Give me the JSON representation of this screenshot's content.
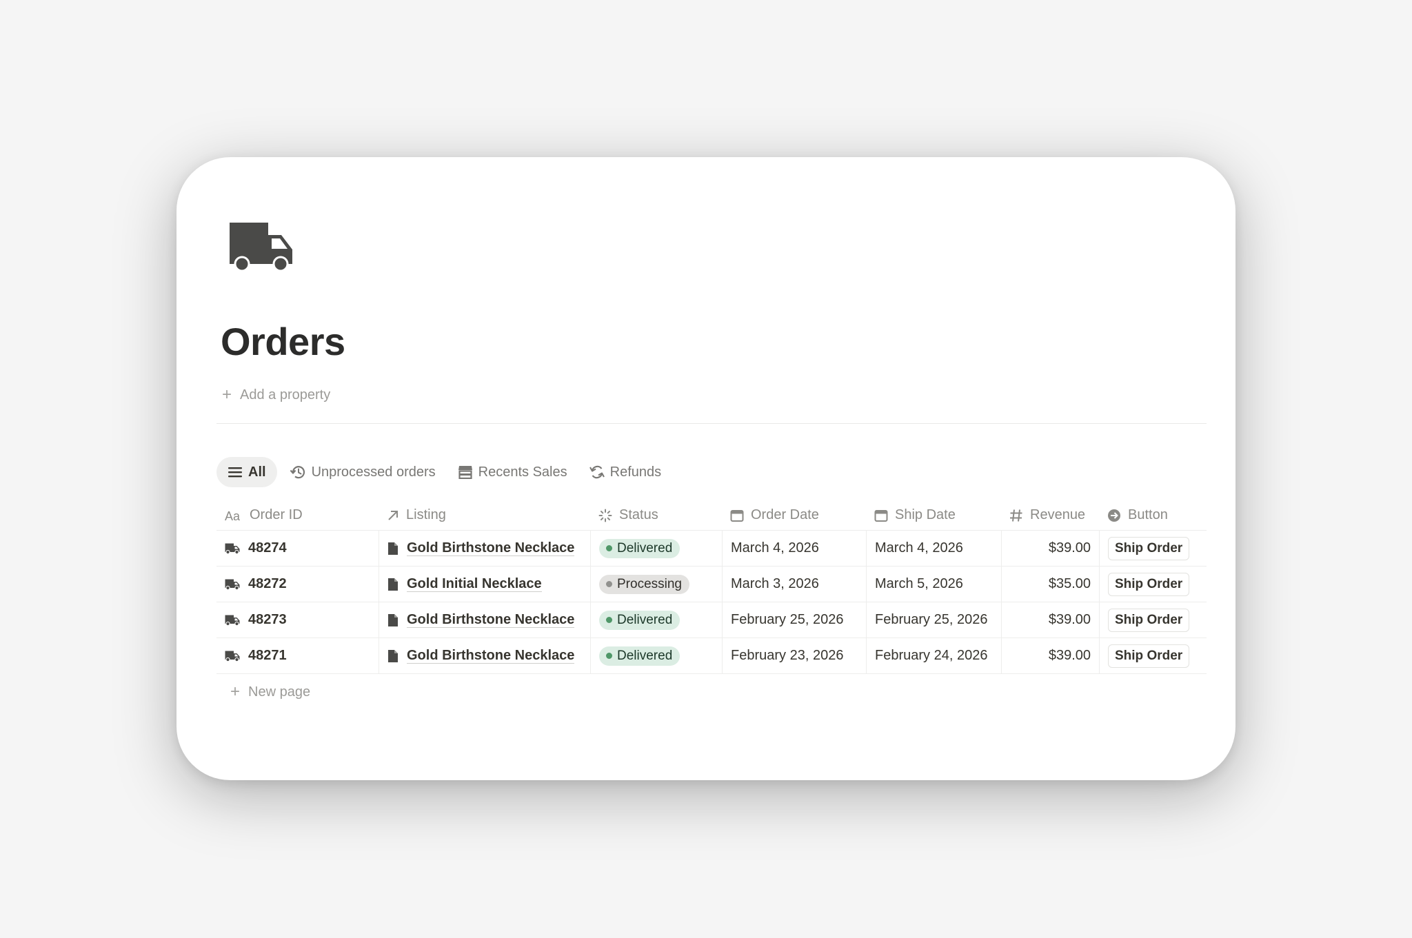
{
  "page": {
    "icon": "truck-icon",
    "title": "Orders",
    "add_property": "Add a property"
  },
  "tabs": [
    {
      "label": "All",
      "icon": "list-icon",
      "active": true
    },
    {
      "label": "Unprocessed orders",
      "icon": "history-icon",
      "active": false
    },
    {
      "label": "Recents Sales",
      "icon": "store-icon",
      "active": false
    },
    {
      "label": "Refunds",
      "icon": "refresh-icon",
      "active": false
    }
  ],
  "table": {
    "columns": [
      {
        "label": "Order ID",
        "icon": "title-aa-icon"
      },
      {
        "label": "Listing",
        "icon": "relation-arrow-icon"
      },
      {
        "label": "Status",
        "icon": "status-spinner-icon"
      },
      {
        "label": "Order Date",
        "icon": "calendar-icon"
      },
      {
        "label": "Ship Date",
        "icon": "calendar-icon"
      },
      {
        "label": "Revenue",
        "icon": "hash-icon"
      },
      {
        "label": "Button",
        "icon": "arrow-circle-icon"
      }
    ],
    "rows": [
      {
        "id": "48274",
        "listing": "Gold Birthstone Necklace",
        "status": "Delivered",
        "order_date": "March 4, 2026",
        "ship_date": "March 4, 2026",
        "revenue": "$39.00",
        "button": "Ship Order"
      },
      {
        "id": "48272",
        "listing": "Gold Initial Necklace",
        "status": "Processing",
        "order_date": "March 3, 2026",
        "ship_date": "March 5, 2026",
        "revenue": "$35.00",
        "button": "Ship Order"
      },
      {
        "id": "48273",
        "listing": "Gold Birthstone Necklace",
        "status": "Delivered",
        "order_date": "February 25, 2026",
        "ship_date": "February 25, 2026",
        "revenue": "$39.00",
        "button": "Ship Order"
      },
      {
        "id": "48271",
        "listing": "Gold Birthstone Necklace",
        "status": "Delivered",
        "order_date": "February 23, 2026",
        "ship_date": "February 24, 2026",
        "revenue": "$39.00",
        "button": "Ship Order"
      }
    ],
    "new_page": "New page"
  },
  "colors": {
    "background": "#f5f5f5",
    "card": "#ffffff",
    "icon_dark": "#4a4a48",
    "delivered_bg": "#dbede3",
    "delivered_dot": "#4f9768",
    "delivered_text": "#1c3829",
    "processing_bg": "#e3e2e0",
    "processing_dot": "#91918e",
    "processing_text": "#32302c"
  }
}
